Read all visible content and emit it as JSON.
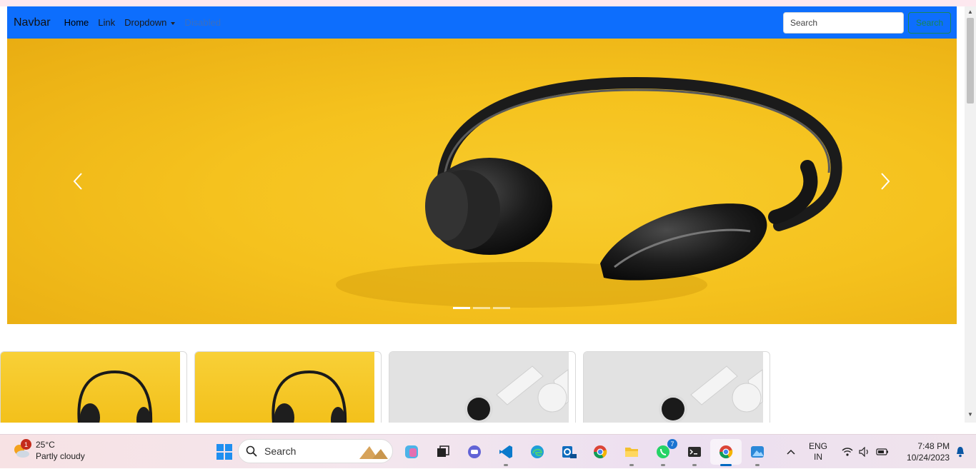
{
  "navbar": {
    "brand": "Navbar",
    "links": [
      {
        "label": "Home",
        "state": "active"
      },
      {
        "label": "Link",
        "state": "normal"
      },
      {
        "label": "Dropdown",
        "state": "dropdown"
      },
      {
        "label": "Disabled",
        "state": "disabled"
      }
    ],
    "search_placeholder": "Search",
    "search_button": "Search",
    "bg_color": "#0d6efd"
  },
  "carousel": {
    "image": "headphones-on-yellow",
    "slides": 3,
    "active_slide": 1,
    "prev_icon": "chevron-left-icon",
    "next_icon": "chevron-right-icon"
  },
  "cards": [
    {
      "image": "headphones-on-yellow"
    },
    {
      "image": "headphones-on-yellow"
    },
    {
      "image": "smartwatches-on-grey"
    },
    {
      "image": "smartwatches-on-grey"
    }
  ],
  "taskbar": {
    "weather": {
      "temp": "25°C",
      "condition": "Partly cloudy",
      "badge": "1"
    },
    "search_label": "Search",
    "apps": [
      {
        "name": "start-icon"
      },
      {
        "name": "copilot-icon"
      },
      {
        "name": "task-view-icon"
      },
      {
        "name": "teams-chat-icon"
      },
      {
        "name": "vscode-icon"
      },
      {
        "name": "edge-icon"
      },
      {
        "name": "outlook-new-icon"
      },
      {
        "name": "chrome-icon"
      },
      {
        "name": "file-explorer-icon"
      },
      {
        "name": "whatsapp-icon",
        "badge": "7"
      },
      {
        "name": "terminal-icon"
      },
      {
        "name": "chrome-active-icon"
      },
      {
        "name": "photos-icon"
      }
    ],
    "lang_line1": "ENG",
    "lang_line2": "IN",
    "time": "7:48 PM",
    "date": "10/24/2023"
  }
}
